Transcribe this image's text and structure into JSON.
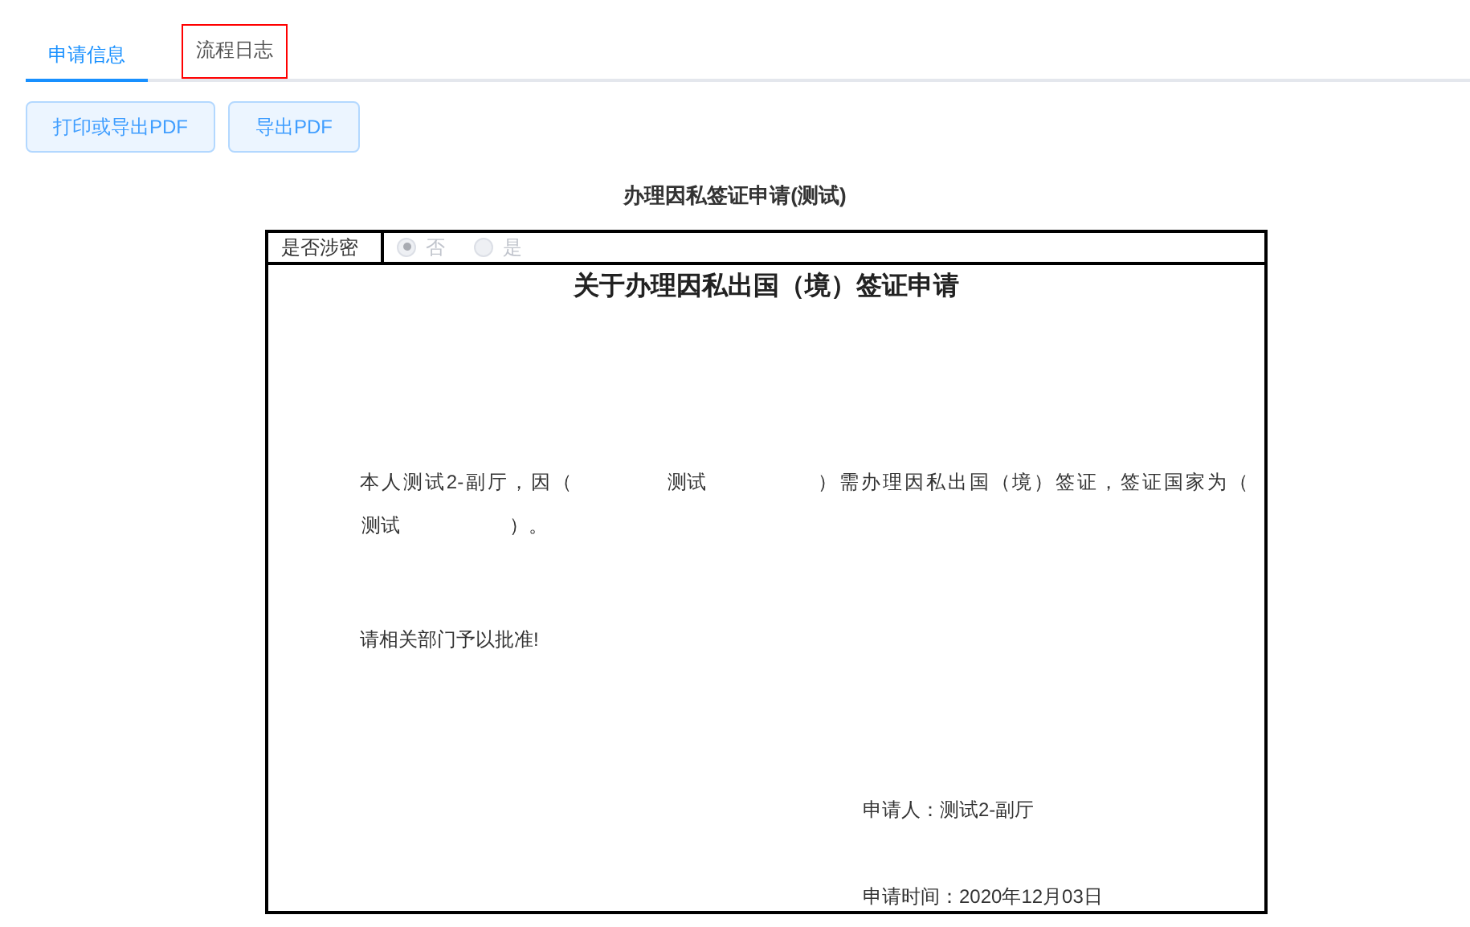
{
  "tabs": [
    {
      "label": "申请信息",
      "selected": true,
      "focused": false
    },
    {
      "label": "流程日志",
      "selected": false,
      "focused": true
    }
  ],
  "buttons": [
    "打印或导出PDF",
    "导出PDF"
  ],
  "form_title": "办理因私签证申请(测试)",
  "secret_field": {
    "label": "是否涉密",
    "options": [
      {
        "label": "否",
        "selected": true,
        "disabled": true
      },
      {
        "label": "是",
        "selected": false,
        "disabled": true
      }
    ]
  },
  "document": {
    "heading": "关于办理因私出国（境）签证申请",
    "paragraph": [
      {
        "kind": "text",
        "text": "本人测试2-副厅，因（"
      },
      {
        "kind": "blank",
        "text": "测试"
      },
      {
        "kind": "text",
        "text": "）需办理因私出国（境）签证，签证国家为（"
      },
      {
        "kind": "blank",
        "text": "测试"
      },
      {
        "kind": "text",
        "text": "）。"
      }
    ],
    "request": "请相关部门予以批准!",
    "applicant": "申请人：测试2-副厅",
    "date": "申请时间：2020年12月03日"
  }
}
